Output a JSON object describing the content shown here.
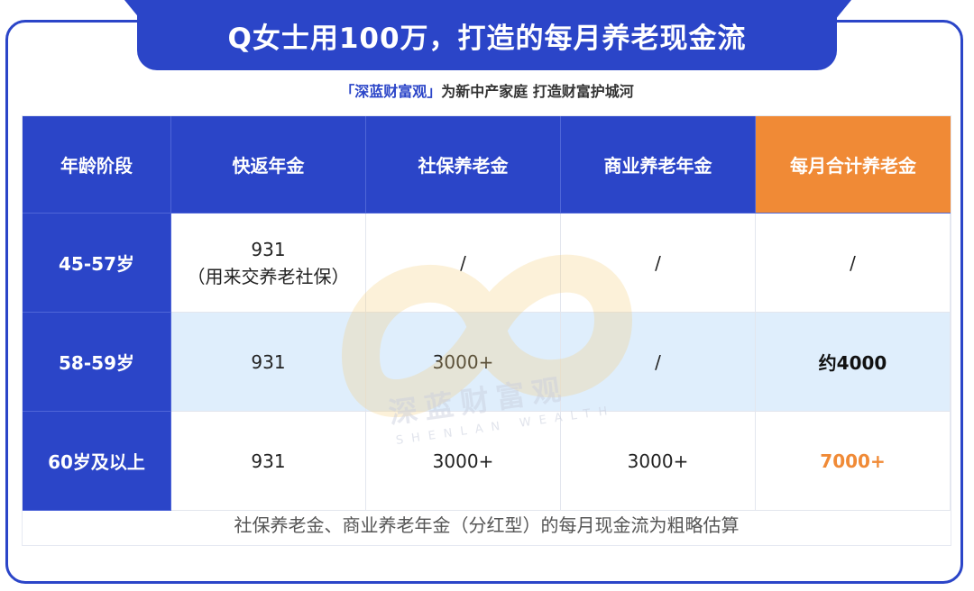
{
  "header": {
    "title": "Q女士用100万，打造的每月养老现金流"
  },
  "subtitle": {
    "brand": "「深蓝财富观」",
    "text": "为新中产家庭 打造财富护城河"
  },
  "table": {
    "headers": [
      "年龄阶段",
      "快返年金",
      "社保养老金",
      "商业养老年金",
      "每月合计养老金"
    ],
    "rows": [
      {
        "stage": "45-57岁",
        "fast_annuity": "931",
        "fast_annuity_note": "（用来交养老社保）",
        "social": "/",
        "commercial": "/",
        "total": "/"
      },
      {
        "stage": "58-59岁",
        "fast_annuity": "931",
        "social": "3000+",
        "commercial": "/",
        "total": "约4000"
      },
      {
        "stage": "60岁及以上",
        "fast_annuity": "931",
        "social": "3000+",
        "commercial": "3000+",
        "total": "7000+"
      }
    ],
    "footnote": "社保养老金、商业养老年金（分红型）的每月现金流为粗略估算"
  },
  "watermark": {
    "brand_cn": "深蓝财富观",
    "brand_en": "SHENLAN WEALTH"
  },
  "colors": {
    "primary": "#2b45c8",
    "accent": "#f08a36",
    "row_highlight": "#dfeefc"
  }
}
